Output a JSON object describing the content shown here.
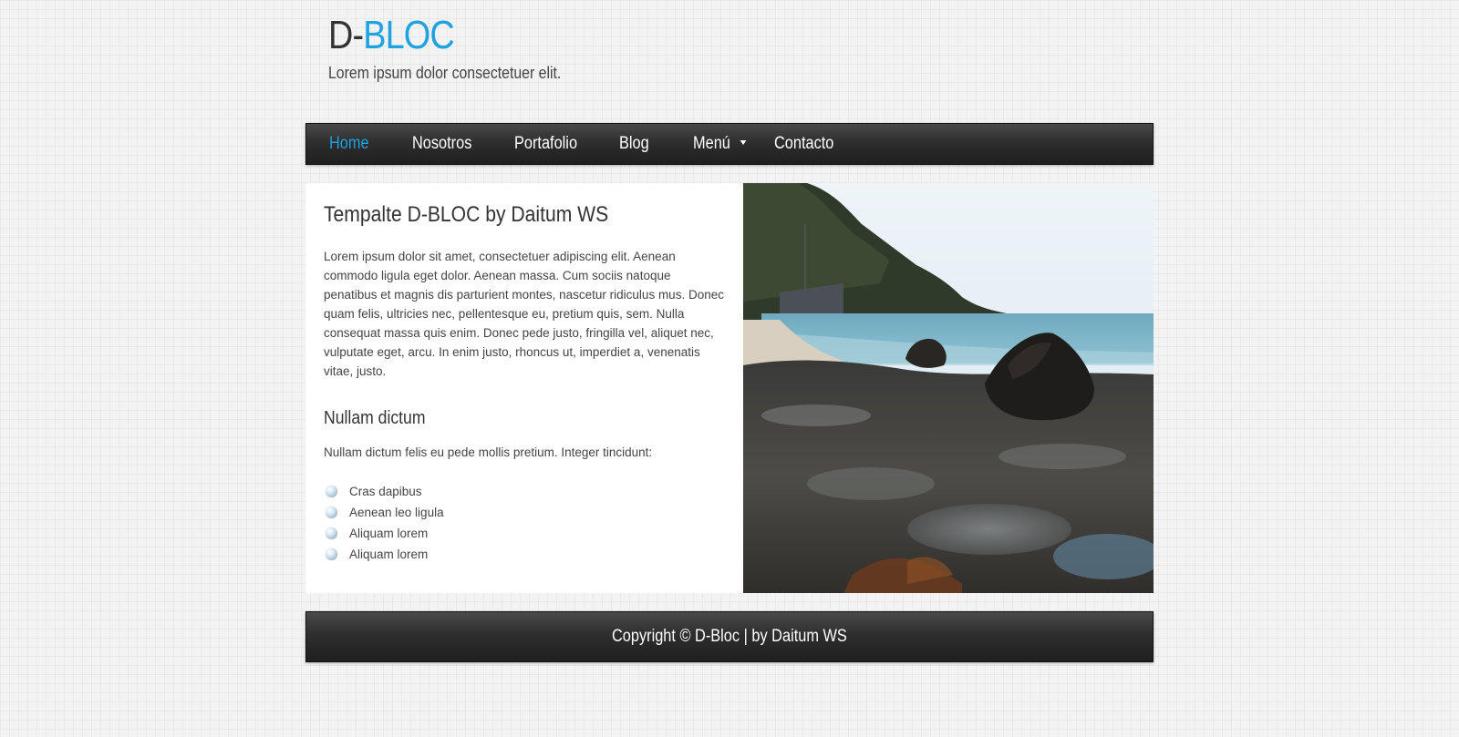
{
  "header": {
    "logo_prefix": "D-",
    "logo_accent": "BLOC",
    "tagline": "Lorem ipsum dolor consectetuer elit."
  },
  "nav": {
    "items": [
      {
        "label": "Home",
        "active": true
      },
      {
        "label": "Nosotros",
        "active": false
      },
      {
        "label": "Portafolio",
        "active": false
      },
      {
        "label": "Blog",
        "active": false
      },
      {
        "label": "Menú",
        "active": false,
        "has_dropdown": true
      },
      {
        "label": "Contacto",
        "active": false
      }
    ]
  },
  "content": {
    "title": "Tempalte D-BLOC by Daitum WS",
    "paragraph": "Lorem ipsum dolor sit amet, consectetuer adipiscing elit. Aenean commodo ligula eget dolor. Aenean massa. Cum sociis natoque penatibus et magnis dis parturient montes, nascetur ridiculus mus. Donec quam felis, ultricies nec, pellentesque eu, pretium quis, sem. Nulla consequat massa quis enim. Donec pede justo, fringilla vel, aliquet nec, vulputate eget, arcu. In enim justo, rhoncus ut, imperdiet a, venenatis vitae, justo.",
    "subtitle": "Nullam dictum",
    "subtext": "Nullam dictum felis eu pede mollis pretium. Integer tincidunt:",
    "list": [
      "Cras dapibus",
      "Aenean leo ligula",
      "Aliquam lorem",
      "Aliquam lorem"
    ]
  },
  "footer": {
    "copyright": "Copyright © D-Bloc | by Daitum WS"
  },
  "colors": {
    "accent": "#1ea2e0",
    "nav_bg": "#2e2e2e",
    "page_bg": "#f3f3f3"
  }
}
